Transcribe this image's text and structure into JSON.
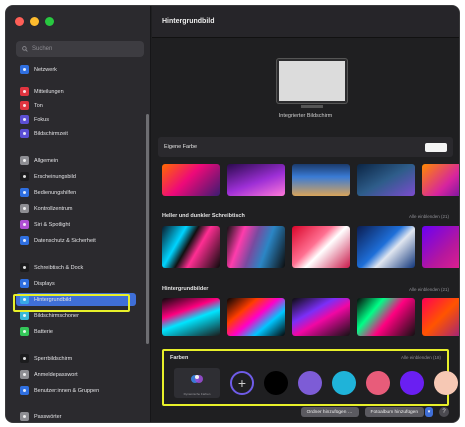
{
  "window": {
    "title": "Hintergrundbild"
  },
  "search": {
    "placeholder": "Suchen"
  },
  "sidebar": {
    "items": [
      {
        "label": "Netzwerk",
        "icon": "globe-icon",
        "color": "#2f6fe0"
      },
      {
        "label": "Mitteilungen",
        "icon": "bell-icon",
        "color": "#e0343f"
      },
      {
        "label": "Ton",
        "icon": "speaker-icon",
        "color": "#e0343f"
      },
      {
        "label": "Fokus",
        "icon": "moon-icon",
        "color": "#5b4fd4"
      },
      {
        "label": "Bildschirmzeit",
        "icon": "hourglass-icon",
        "color": "#5b4fd4"
      },
      {
        "label": "Allgemein",
        "icon": "gear-icon",
        "color": "#8e8e93"
      },
      {
        "label": "Erscheinungsbild",
        "icon": "appearance-icon",
        "color": "#1c1c1e"
      },
      {
        "label": "Bedienungshilfen",
        "icon": "accessibility-icon",
        "color": "#2f6fe0"
      },
      {
        "label": "Kontrollzentrum",
        "icon": "control-center-icon",
        "color": "#8e8e93"
      },
      {
        "label": "Siri & Spotlight",
        "icon": "siri-icon",
        "color": "#b04fd4"
      },
      {
        "label": "Datenschutz & Sicherheit",
        "icon": "hand-icon",
        "color": "#2f6fe0"
      },
      {
        "label": "Schreibtisch & Dock",
        "icon": "dock-icon",
        "color": "#1c1c1e"
      },
      {
        "label": "Displays",
        "icon": "display-icon",
        "color": "#2f6fe0"
      },
      {
        "label": "Hintergrundbild",
        "icon": "wallpaper-icon",
        "color": "#38a8e6"
      },
      {
        "label": "Bildschirmschoner",
        "icon": "screensaver-icon",
        "color": "#38b8d6"
      },
      {
        "label": "Batterie",
        "icon": "battery-icon",
        "color": "#34c759"
      },
      {
        "label": "Sperrbildschirm",
        "icon": "lock-screen-icon",
        "color": "#1c1c1e"
      },
      {
        "label": "Anmeldepasswort",
        "icon": "lock-icon",
        "color": "#8e8e93"
      },
      {
        "label": "Benutzer:innen & Gruppen",
        "icon": "users-icon",
        "color": "#2f6fe0"
      },
      {
        "label": "Passwörter",
        "icon": "key-icon",
        "color": "#8e8e93"
      }
    ],
    "selected_index": 13
  },
  "display": {
    "label": "Integrierter Bildschirm"
  },
  "sections": {
    "eigene": {
      "title": "Eigene Farbe",
      "swatch_color": "#f4f4f4"
    },
    "hell_dunkel": {
      "title": "Heller und dunkler Schreibtisch",
      "more": "Alle einblenden (21)"
    },
    "hintergrundbilder": {
      "title": "Hintergrundbilder",
      "more": "Alle einblenden (21)"
    },
    "farben": {
      "title": "Farben",
      "more": "Alle einblenden (18)",
      "dynamic_label": "Dynamische Farben",
      "dots": [
        "#000000",
        "#7d5cd6",
        "#1fb3d9",
        "#e85c7a",
        "#6a1ff2",
        "#f6c8b4"
      ]
    }
  },
  "footer": {
    "add_folder": "Ordner hinzufügen …",
    "add_album": "Fotoalbum hinzufügen",
    "help": "?"
  }
}
